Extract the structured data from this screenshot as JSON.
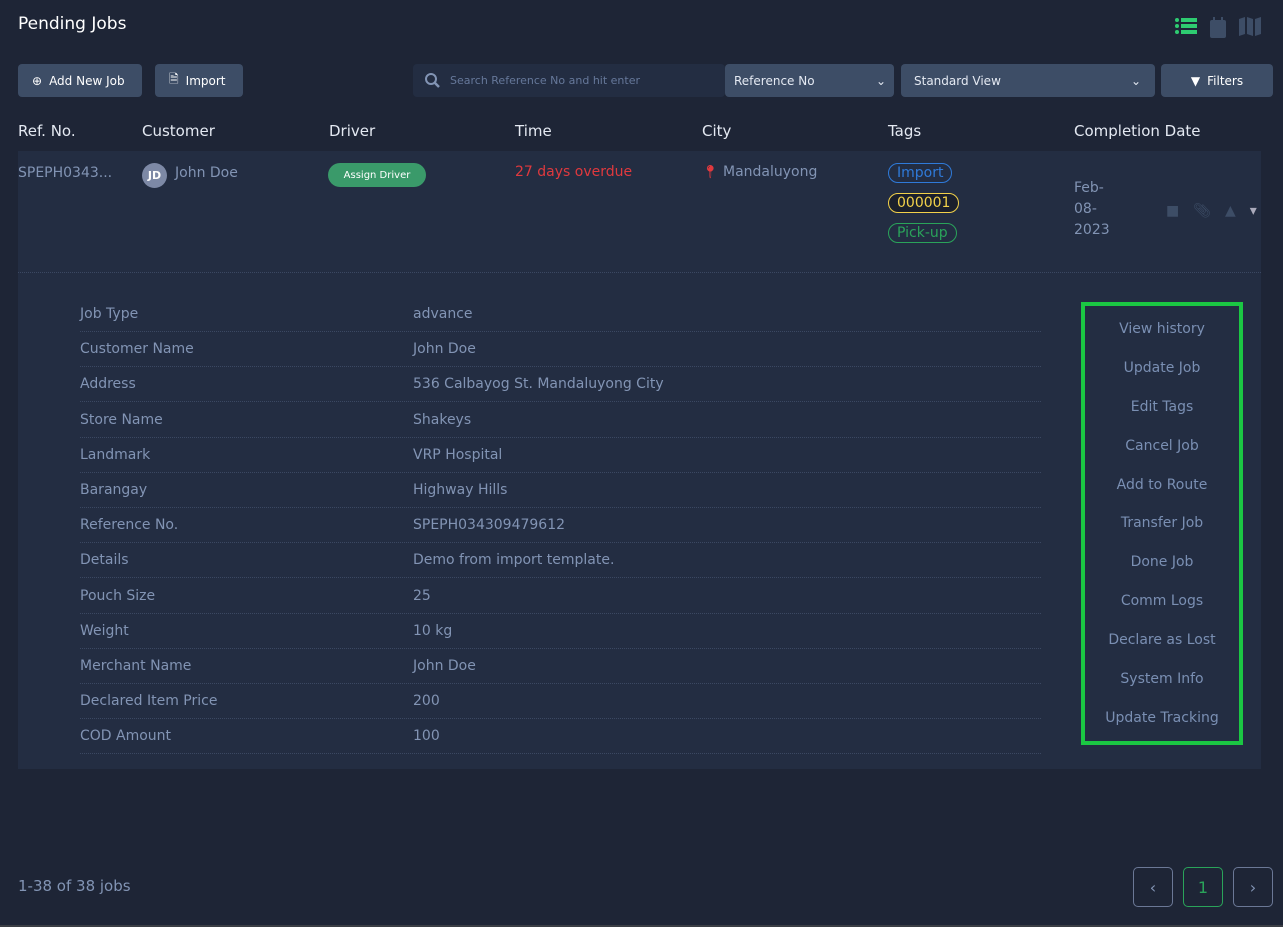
{
  "page_title": "Pending Jobs",
  "toolbar": {
    "add_label": "Add New Job",
    "import_label": "Import",
    "search_placeholder": "Search Reference No and hit enter",
    "search_field": "Reference No",
    "view": "Standard View",
    "filters_label": "Filters"
  },
  "columns": [
    "Ref. No.",
    "Customer",
    "Driver",
    "Time",
    "City",
    "Tags",
    "Completion Date"
  ],
  "job": {
    "ref": "SPEPH0343...",
    "initials": "JD",
    "customer": "John Doe",
    "driver_btn": "Assign Driver",
    "time": "27 days overdue",
    "city": "Mandaluyong",
    "tags": [
      {
        "label": "Import",
        "color": "#2f7ad9"
      },
      {
        "label": "000001",
        "color": "#f2d14a"
      },
      {
        "label": "Pick-up",
        "color": "#2aa35a"
      }
    ],
    "date": [
      "Feb-",
      "08-",
      "2023"
    ]
  },
  "details": [
    [
      "Job Type",
      "advance"
    ],
    [
      "Customer Name",
      "John Doe"
    ],
    [
      "Address",
      "536 Calbayog St. Mandaluyong City"
    ],
    [
      "Store Name",
      "Shakeys"
    ],
    [
      "Landmark",
      "VRP Hospital"
    ],
    [
      "Barangay",
      "Highway Hills"
    ],
    [
      "Reference No.",
      "SPEPH034309479612"
    ],
    [
      "Details",
      "Demo from import template."
    ],
    [
      "Pouch Size",
      "25"
    ],
    [
      "Weight",
      "10 kg"
    ],
    [
      "Merchant Name",
      "John Doe"
    ],
    [
      "Declared Item Price",
      "200"
    ],
    [
      "COD Amount",
      "100"
    ]
  ],
  "actions": [
    "View history",
    "Update Job",
    "Edit Tags",
    "Cancel Job",
    "Add to Route",
    "Transfer Job",
    "Done Job",
    "Comm Logs",
    "Declare as Lost",
    "System Info",
    "Update Tracking"
  ],
  "pagination": {
    "summary": "1-38 of 38 jobs",
    "current": "1",
    "prev": "‹",
    "next": "›"
  },
  "colors": {
    "accent": "#2ecc71",
    "overdue": "#e0393e",
    "highlight": "#1bc743"
  }
}
